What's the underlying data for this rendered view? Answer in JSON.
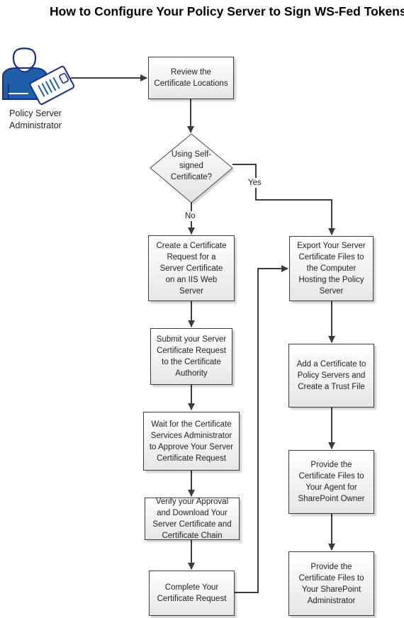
{
  "title": "How to Configure Your Policy Server to Sign WS-Fed Tokens",
  "actor": {
    "icon": "administrator-with-clipboard-icon",
    "label_line1": "Policy Server",
    "label_line2": "Administrator"
  },
  "colors": {
    "actor_blue": "#1f5fa8",
    "actor_dark": "#1b2f8a",
    "line": "#3c3c3c",
    "box_border": "#3c3c3c"
  },
  "steps": {
    "review": [
      "Review the",
      "Certificate Locations"
    ],
    "decision": [
      "Using Self-",
      "signed",
      "Certificate?"
    ],
    "decision_yes": "Yes",
    "decision_no": "No",
    "create_request": [
      "Create a Certificate",
      "Request for a",
      "Server Certificate",
      "on an IIS Web",
      "Server"
    ],
    "submit_request": [
      "Submit your Server",
      "Certificate Request",
      "to the Certificate",
      "Authority"
    ],
    "wait_approval": [
      "Wait for the Certificate",
      "Services Administrator",
      "to Approve Your Server",
      "Certificate Request"
    ],
    "verify_download": [
      "Verify your Approval",
      "and Download Your",
      "Server Certificate and",
      "Certificate Chain"
    ],
    "complete_request": [
      "Complete Your",
      "Certificate Request"
    ],
    "export_files": [
      "Export Your Server",
      "Certificate Files to",
      "the Computer",
      "Hosting the Policy",
      "Server"
    ],
    "add_certificate": [
      "Add a Certificate to",
      "Policy Servers and",
      "Create a Trust File"
    ],
    "provide_agent_owner": [
      "Provide the",
      "Certificate Files to",
      "Your Agent for",
      "SharePoint Owner"
    ],
    "provide_sp_admin": [
      "Provide the",
      "Certificate Files to",
      "Your SharePoint",
      "Administrator"
    ]
  }
}
